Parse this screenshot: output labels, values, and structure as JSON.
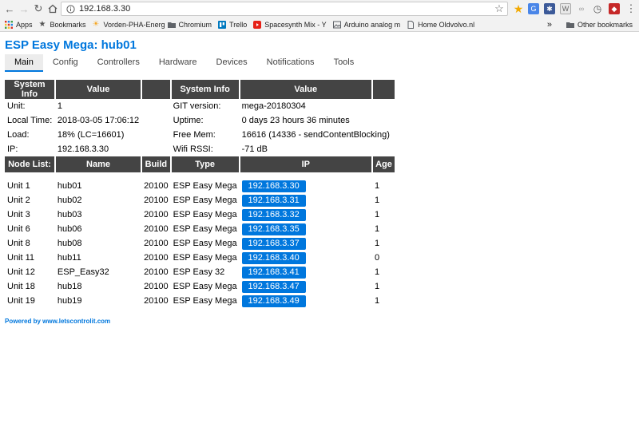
{
  "browser": {
    "url": "192.168.3.30",
    "bookmarks": [
      {
        "label": "Apps",
        "icon": "apps-grid-icon"
      },
      {
        "label": "Bookmarks",
        "icon": "star-icon"
      },
      {
        "label": "Vorden-PHA-Energ",
        "icon": "sun-icon"
      },
      {
        "label": "Chromium",
        "icon": "folder-icon"
      },
      {
        "label": "Trello",
        "icon": "trello-icon"
      },
      {
        "label": "Spacesynth Mix - Y",
        "icon": "youtube-icon"
      },
      {
        "label": "Arduino analog m",
        "icon": "image-icon"
      },
      {
        "label": "Home Oldvolvo.nl",
        "icon": "page-icon"
      }
    ],
    "overflow": "»",
    "other_bookmarks": "Other bookmarks"
  },
  "page": {
    "title": "ESP Easy Mega: hub01",
    "tabs": [
      "Main",
      "Config",
      "Controllers",
      "Hardware",
      "Devices",
      "Notifications",
      "Tools"
    ],
    "active_tab": "Main"
  },
  "sysinfo": {
    "headers": [
      "System Info",
      "Value",
      "System Info",
      "Value"
    ],
    "rows": [
      [
        "Unit:",
        "1",
        "GIT version:",
        "mega-20180304"
      ],
      [
        "Local Time:",
        "2018-03-05 17:06:12",
        "Uptime:",
        "0 days 23 hours 36 minutes"
      ],
      [
        "Load:",
        "18% (LC=16601)",
        "Free Mem:",
        "16616 (14336 - sendContentBlocking)"
      ],
      [
        "IP:",
        "192.168.3.30",
        "Wifi RSSI:",
        "-71 dB"
      ]
    ]
  },
  "nodes": {
    "headers": [
      "Node List:",
      "Name",
      "Build",
      "Type",
      "IP",
      "Age"
    ],
    "rows": [
      {
        "unit": "Unit 1",
        "name": "hub01",
        "build": "20100",
        "type": "ESP Easy Mega",
        "ip": "192.168.3.30",
        "age": "1"
      },
      {
        "unit": "Unit 2",
        "name": "hub02",
        "build": "20100",
        "type": "ESP Easy Mega",
        "ip": "192.168.3.31",
        "age": "1"
      },
      {
        "unit": "Unit 3",
        "name": "hub03",
        "build": "20100",
        "type": "ESP Easy Mega",
        "ip": "192.168.3.32",
        "age": "1"
      },
      {
        "unit": "Unit 6",
        "name": "hub06",
        "build": "20100",
        "type": "ESP Easy Mega",
        "ip": "192.168.3.35",
        "age": "1"
      },
      {
        "unit": "Unit 8",
        "name": "hub08",
        "build": "20100",
        "type": "ESP Easy Mega",
        "ip": "192.168.3.37",
        "age": "1"
      },
      {
        "unit": "Unit 11",
        "name": "hub11",
        "build": "20100",
        "type": "ESP Easy Mega",
        "ip": "192.168.3.40",
        "age": "0"
      },
      {
        "unit": "Unit 12",
        "name": "ESP_Easy32",
        "build": "20100",
        "type": "ESP Easy 32",
        "ip": "192.168.3.41",
        "age": "1"
      },
      {
        "unit": "Unit 18",
        "name": "hub18",
        "build": "20100",
        "type": "ESP Easy Mega",
        "ip": "192.168.3.47",
        "age": "1"
      },
      {
        "unit": "Unit 19",
        "name": "hub19",
        "build": "20100",
        "type": "ESP Easy Mega",
        "ip": "192.168.3.49",
        "age": "1"
      }
    ]
  },
  "footer": "Powered by www.letscontrolit.com",
  "colors": {
    "accent": "#0077dd",
    "header_bg": "#444444"
  }
}
